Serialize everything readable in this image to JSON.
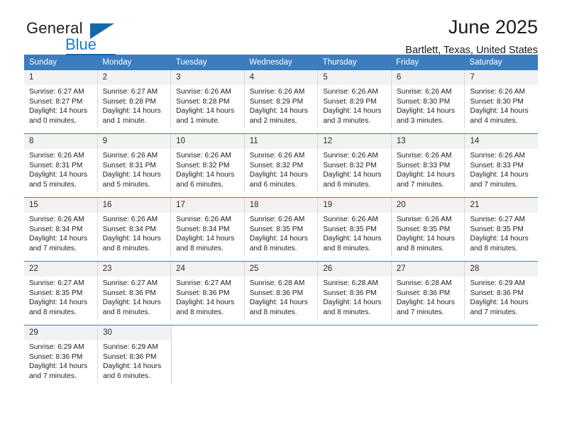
{
  "brand": {
    "name_part1": "General",
    "name_part2": "Blue",
    "accent_color": "#1567ad"
  },
  "header": {
    "title": "June 2025",
    "subtitle": "Bartlett, Texas, United States"
  },
  "calendar": {
    "header_bg": "#3b7dbf",
    "weekdays": [
      "Sunday",
      "Monday",
      "Tuesday",
      "Wednesday",
      "Thursday",
      "Friday",
      "Saturday"
    ],
    "weeks": [
      [
        {
          "day": "1",
          "sunrise": "Sunrise: 6:27 AM",
          "sunset": "Sunset: 8:27 PM",
          "daylight": "Daylight: 14 hours and 0 minutes."
        },
        {
          "day": "2",
          "sunrise": "Sunrise: 6:27 AM",
          "sunset": "Sunset: 8:28 PM",
          "daylight": "Daylight: 14 hours and 1 minute."
        },
        {
          "day": "3",
          "sunrise": "Sunrise: 6:26 AM",
          "sunset": "Sunset: 8:28 PM",
          "daylight": "Daylight: 14 hours and 1 minute."
        },
        {
          "day": "4",
          "sunrise": "Sunrise: 6:26 AM",
          "sunset": "Sunset: 8:29 PM",
          "daylight": "Daylight: 14 hours and 2 minutes."
        },
        {
          "day": "5",
          "sunrise": "Sunrise: 6:26 AM",
          "sunset": "Sunset: 8:29 PM",
          "daylight": "Daylight: 14 hours and 3 minutes."
        },
        {
          "day": "6",
          "sunrise": "Sunrise: 6:26 AM",
          "sunset": "Sunset: 8:30 PM",
          "daylight": "Daylight: 14 hours and 3 minutes."
        },
        {
          "day": "7",
          "sunrise": "Sunrise: 6:26 AM",
          "sunset": "Sunset: 8:30 PM",
          "daylight": "Daylight: 14 hours and 4 minutes."
        }
      ],
      [
        {
          "day": "8",
          "sunrise": "Sunrise: 6:26 AM",
          "sunset": "Sunset: 8:31 PM",
          "daylight": "Daylight: 14 hours and 5 minutes."
        },
        {
          "day": "9",
          "sunrise": "Sunrise: 6:26 AM",
          "sunset": "Sunset: 8:31 PM",
          "daylight": "Daylight: 14 hours and 5 minutes."
        },
        {
          "day": "10",
          "sunrise": "Sunrise: 6:26 AM",
          "sunset": "Sunset: 8:32 PM",
          "daylight": "Daylight: 14 hours and 6 minutes."
        },
        {
          "day": "11",
          "sunrise": "Sunrise: 6:26 AM",
          "sunset": "Sunset: 8:32 PM",
          "daylight": "Daylight: 14 hours and 6 minutes."
        },
        {
          "day": "12",
          "sunrise": "Sunrise: 6:26 AM",
          "sunset": "Sunset: 8:32 PM",
          "daylight": "Daylight: 14 hours and 6 minutes."
        },
        {
          "day": "13",
          "sunrise": "Sunrise: 6:26 AM",
          "sunset": "Sunset: 8:33 PM",
          "daylight": "Daylight: 14 hours and 7 minutes."
        },
        {
          "day": "14",
          "sunrise": "Sunrise: 6:26 AM",
          "sunset": "Sunset: 8:33 PM",
          "daylight": "Daylight: 14 hours and 7 minutes."
        }
      ],
      [
        {
          "day": "15",
          "sunrise": "Sunrise: 6:26 AM",
          "sunset": "Sunset: 8:34 PM",
          "daylight": "Daylight: 14 hours and 7 minutes."
        },
        {
          "day": "16",
          "sunrise": "Sunrise: 6:26 AM",
          "sunset": "Sunset: 8:34 PM",
          "daylight": "Daylight: 14 hours and 8 minutes."
        },
        {
          "day": "17",
          "sunrise": "Sunrise: 6:26 AM",
          "sunset": "Sunset: 8:34 PM",
          "daylight": "Daylight: 14 hours and 8 minutes."
        },
        {
          "day": "18",
          "sunrise": "Sunrise: 6:26 AM",
          "sunset": "Sunset: 8:35 PM",
          "daylight": "Daylight: 14 hours and 8 minutes."
        },
        {
          "day": "19",
          "sunrise": "Sunrise: 6:26 AM",
          "sunset": "Sunset: 8:35 PM",
          "daylight": "Daylight: 14 hours and 8 minutes."
        },
        {
          "day": "20",
          "sunrise": "Sunrise: 6:26 AM",
          "sunset": "Sunset: 8:35 PM",
          "daylight": "Daylight: 14 hours and 8 minutes."
        },
        {
          "day": "21",
          "sunrise": "Sunrise: 6:27 AM",
          "sunset": "Sunset: 8:35 PM",
          "daylight": "Daylight: 14 hours and 8 minutes."
        }
      ],
      [
        {
          "day": "22",
          "sunrise": "Sunrise: 6:27 AM",
          "sunset": "Sunset: 8:35 PM",
          "daylight": "Daylight: 14 hours and 8 minutes."
        },
        {
          "day": "23",
          "sunrise": "Sunrise: 6:27 AM",
          "sunset": "Sunset: 8:36 PM",
          "daylight": "Daylight: 14 hours and 8 minutes."
        },
        {
          "day": "24",
          "sunrise": "Sunrise: 6:27 AM",
          "sunset": "Sunset: 8:36 PM",
          "daylight": "Daylight: 14 hours and 8 minutes."
        },
        {
          "day": "25",
          "sunrise": "Sunrise: 6:28 AM",
          "sunset": "Sunset: 8:36 PM",
          "daylight": "Daylight: 14 hours and 8 minutes."
        },
        {
          "day": "26",
          "sunrise": "Sunrise: 6:28 AM",
          "sunset": "Sunset: 8:36 PM",
          "daylight": "Daylight: 14 hours and 8 minutes."
        },
        {
          "day": "27",
          "sunrise": "Sunrise: 6:28 AM",
          "sunset": "Sunset: 8:36 PM",
          "daylight": "Daylight: 14 hours and 7 minutes."
        },
        {
          "day": "28",
          "sunrise": "Sunrise: 6:29 AM",
          "sunset": "Sunset: 8:36 PM",
          "daylight": "Daylight: 14 hours and 7 minutes."
        }
      ],
      [
        {
          "day": "29",
          "sunrise": "Sunrise: 6:29 AM",
          "sunset": "Sunset: 8:36 PM",
          "daylight": "Daylight: 14 hours and 7 minutes."
        },
        {
          "day": "30",
          "sunrise": "Sunrise: 6:29 AM",
          "sunset": "Sunset: 8:36 PM",
          "daylight": "Daylight: 14 hours and 6 minutes."
        },
        {
          "day": "",
          "sunrise": "",
          "sunset": "",
          "daylight": ""
        },
        {
          "day": "",
          "sunrise": "",
          "sunset": "",
          "daylight": ""
        },
        {
          "day": "",
          "sunrise": "",
          "sunset": "",
          "daylight": ""
        },
        {
          "day": "",
          "sunrise": "",
          "sunset": "",
          "daylight": ""
        },
        {
          "day": "",
          "sunrise": "",
          "sunset": "",
          "daylight": ""
        }
      ]
    ]
  }
}
